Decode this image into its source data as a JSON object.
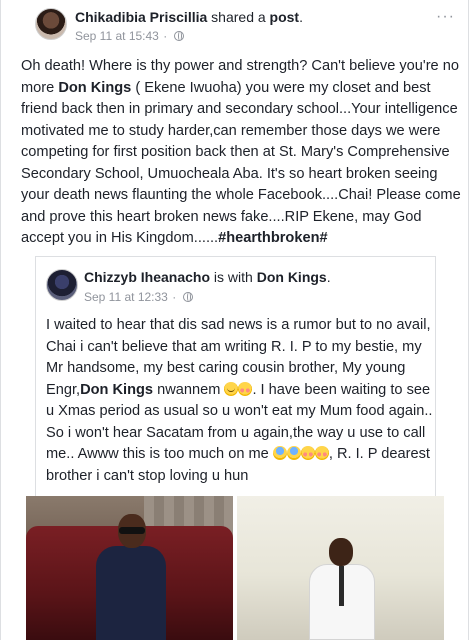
{
  "post": {
    "author": "Chikadibia Priscillia",
    "action_prefix": " shared a ",
    "action_link": "post",
    "action_suffix": ".",
    "date": "Sep 11 at 15:43",
    "separator": "·",
    "more_label": "···",
    "text_1": "Oh death! Where is thy power and strength? Can't believe you're no more ",
    "tag_1": "Don Kings",
    "text_2": " ( Ekene Iwuoha) you were my closet and best friend back then in primary and secondary school...Your intelligence motivated me to study harder,can remember those days we were competing for first position back then at St. Mary's Comprehensive Secondary School, Umuocheala Aba. It's so heart broken seeing your death news flaunting the whole Facebook....Chai! Please come and prove this heart broken news fake....RIP Ekene, may God accept you in His Kingdom......",
    "hashtag": "#hearthbroken#"
  },
  "shared": {
    "author": "Chizzyb Iheanacho",
    "with_text": " is with ",
    "tagged": "Don Kings",
    "end": ".",
    "date": "Sep 11 at 12:33",
    "separator": "·",
    "text_1": "I waited to hear that dis sad news is a rumor but to no avail, Chai i can't believe that am writing R. I. P to my bestie, my Mr handsome, my best caring cousin brother, My young Engr,",
    "tag": "Don Kings",
    "text_2": " nwannem ",
    "text_3": ". I have been waiting to see u Xmas period as usual so  u won't eat my Mum food again.. So i won't hear Sacatam from u again,the way u use to call me..  Awww  this is too much on me ",
    "text_4": ", R. I. P dearest brother  i can't stop loving u hun"
  }
}
